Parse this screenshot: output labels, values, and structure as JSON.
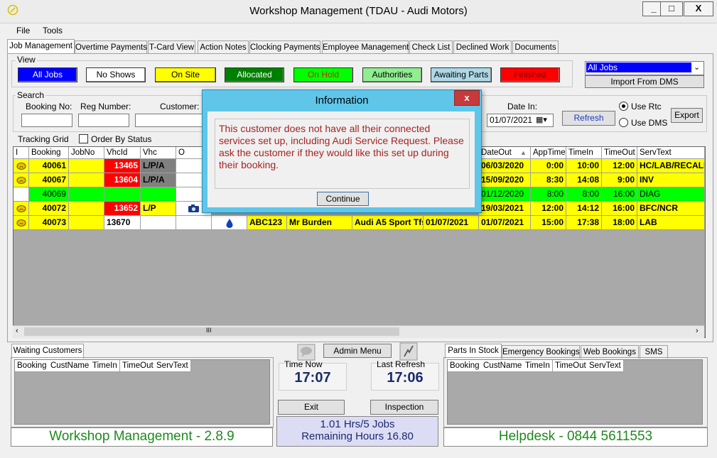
{
  "window": {
    "title": "Workshop Management   (TDAU - Audi Motors)",
    "minimize": "_",
    "maximize": "□",
    "close": "X"
  },
  "menu": [
    "File",
    "Tools"
  ],
  "tabs": [
    "Job Management",
    "Overtime Payments",
    "T-Card View",
    "Action Notes",
    "Clocking Payments",
    "Employee Management",
    "Check List",
    "Declined Work",
    "Documents"
  ],
  "view": {
    "label": "View",
    "buttons": [
      {
        "label": "All Jobs",
        "bg": "#0000ff",
        "fg": "#ffffff"
      },
      {
        "label": "No Shows",
        "bg": "#ffffff",
        "fg": "#000000"
      },
      {
        "label": "On Site",
        "bg": "#ffff00",
        "fg": "#000000"
      },
      {
        "label": "Allocated",
        "bg": "#008000",
        "fg": "#ffffff"
      },
      {
        "label": "On Hold",
        "bg": "#00ff00",
        "fg": "#a04000"
      },
      {
        "label": "Authorities",
        "bg": "#90ee90",
        "fg": "#000000"
      },
      {
        "label": "Awaiting Parts",
        "bg": "#add8e6",
        "fg": "#000000"
      },
      {
        "label": "Finished",
        "bg": "#ff0000",
        "fg": "#800000"
      }
    ],
    "filter_select": "All Jobs",
    "import_button": "Import From DMS"
  },
  "search": {
    "label": "Search",
    "booking_no_label": "Booking No:",
    "reg_number_label": "Reg Number:",
    "customer_label": "Customer:",
    "date_in_label": "Date In:",
    "date_in_value": "01/07/2021",
    "refresh": "Refresh",
    "use_rtc": "Use Rtc",
    "use_dms": "Use DMS",
    "export": "Export"
  },
  "tracking": {
    "label": "Tracking Grid",
    "order_by_status": "Order By Status"
  },
  "grid": {
    "headers": [
      "I",
      "Booking",
      "JobNo",
      "VhcId",
      "Vhc",
      "O",
      "DateOut",
      "AppTime",
      "TimeIn",
      "TimeOut",
      "ServText"
    ],
    "rows": [
      {
        "booking": "40061",
        "jobno": "",
        "vhcid": "13465",
        "vhc": "L/P/A",
        "dateout": "06/03/2020",
        "apptime": "0:00",
        "timein": "10:00",
        "timeout": "12:00",
        "servtext": "HC/LAB/RECALL"
      },
      {
        "booking": "40067",
        "jobno": "",
        "vhcid": "13604",
        "vhc": "L/P/A",
        "dateout": "15/09/2020",
        "apptime": "8:30",
        "timein": "14:08",
        "timeout": "9:00",
        "servtext": "INV"
      },
      {
        "booking": "40069",
        "jobno": "",
        "vhcid": "",
        "vhc": "",
        "dateout": "01/12/2020",
        "apptime": "8:00",
        "timein": "8:00",
        "timeout": "16:00",
        "servtext": "DIAG"
      },
      {
        "booking": "40072",
        "jobno": "",
        "vhcid": "13652",
        "vhc": "L/P",
        "dateout": "19/03/2021",
        "apptime": "12:00",
        "timein": "14:12",
        "timeout": "16:00",
        "servtext": "BFC/NCR"
      },
      {
        "booking": "40073",
        "jobno": "",
        "vhcid": "13670",
        "vhc": "",
        "reg": "ABC123",
        "customer": "Mr Burden",
        "vehicle": "Audi A5 Sport Tfs",
        "datein": "01/07/2021",
        "dateout": "01/07/2021",
        "apptime": "15:00",
        "timein": "17:38",
        "timeout": "18:00",
        "servtext": "LAB"
      }
    ],
    "scroll_thumb": "III"
  },
  "waiting": {
    "tab": "Waiting Customers",
    "headers": [
      "Booking",
      "CustName",
      "TimeIn",
      "TimeOut",
      "ServText"
    ]
  },
  "center": {
    "admin_menu": "Admin Menu",
    "time_now_label": "Time Now",
    "time_now": "17:07",
    "last_refresh_label": "Last Refresh",
    "last_refresh": "17:06",
    "exit": "Exit",
    "inspection": "Inspection",
    "summary_line1": "1.01 Hrs/5 Jobs",
    "summary_line2": "Remaining Hours 16.80"
  },
  "parts": {
    "tabs": [
      "Parts In Stock",
      "Emergency Bookings",
      "Web Bookings",
      "SMS"
    ],
    "headers": [
      "Booking",
      "CustName",
      "TimeIn",
      "TimeOut",
      "ServText"
    ]
  },
  "footer": {
    "left": "Workshop Management - 2.8.9",
    "right": "Helpdesk - 0844 5611553"
  },
  "dialog": {
    "title": "Information",
    "close": "x",
    "message": "This customer does not have all their connected services set up, including Audi Service Request. Please ask the customer if they would like this set up during their booking.",
    "button": "Continue"
  },
  "colors": {
    "yellow": "#ffff00",
    "green": "#00ff00",
    "red": "#ff0000",
    "gray": "#808080",
    "dialog_title": "#5fc6ea",
    "message_text": "#a72323",
    "footer_text": "#1e8a1e"
  }
}
